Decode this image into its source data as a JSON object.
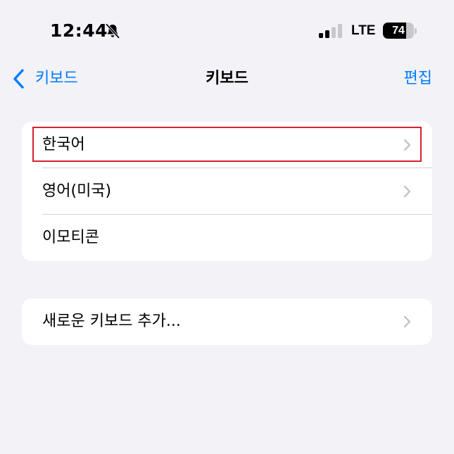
{
  "status_bar": {
    "time": "12:44",
    "network": "LTE",
    "battery_level": "74",
    "icons": [
      "bell-slash-icon",
      "signal-icon",
      "battery-icon"
    ]
  },
  "nav": {
    "back_label": "키보드",
    "title": "키보드",
    "edit_label": "편집"
  },
  "keyboards": [
    {
      "label": "한국어",
      "has_chevron": true
    },
    {
      "label": "영어(미국)",
      "has_chevron": true
    },
    {
      "label": "이모티콘",
      "has_chevron": false
    }
  ],
  "add_keyboard": {
    "label": "새로운 키보드 추가..."
  },
  "colors": {
    "accent": "#007aff",
    "background": "#f2f2f7",
    "highlight": "#d62232"
  }
}
